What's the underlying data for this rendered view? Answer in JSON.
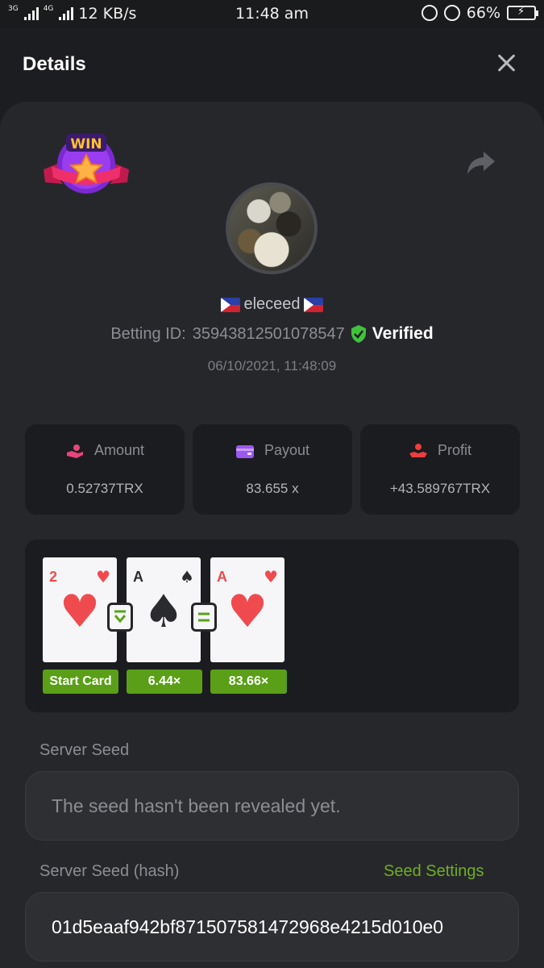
{
  "status_bar": {
    "network_left": "3G",
    "network_right": "4G",
    "speed": "12 KB/s",
    "time": "11:48 am",
    "battery": "66%",
    "battery_level": 0.66
  },
  "header": {
    "title": "Details"
  },
  "badge": {
    "text": "WIN"
  },
  "user": {
    "username": "eleceed",
    "betting_id_label": "Betting ID:",
    "betting_id": "35943812501078547",
    "verified_label": "Verified",
    "datetime": "06/10/2021, 11:48:09"
  },
  "stats": [
    {
      "label": "Amount",
      "value": "0.52737TRX",
      "icon": "hand-coin-icon",
      "color": "#e8457a"
    },
    {
      "label": "Payout",
      "value": "83.655 x",
      "icon": "wallet-icon",
      "color": "#9b59ef"
    },
    {
      "label": "Profit",
      "value": "+43.589767TRX",
      "icon": "hand-profit-icon",
      "color": "#ee3d3d"
    }
  ],
  "cards": [
    {
      "rank": "2",
      "suit": "♥",
      "color": "red",
      "multiplier": "Start Card"
    },
    {
      "rank": "A",
      "suit": "♠",
      "color": "black",
      "multiplier": "6.44×"
    },
    {
      "rank": "A",
      "suit": "♥",
      "color": "red",
      "multiplier": "83.66×"
    }
  ],
  "connectors": [
    "lower-equal-icon",
    "equal-icon"
  ],
  "server_seed": {
    "label": "Server Seed",
    "placeholder": "The seed hasn't been revealed yet."
  },
  "server_seed_hash": {
    "label": "Server Seed (hash)",
    "settings_link": "Seed Settings",
    "value": "01d5eaaf942bf871507581472968e4215d010e0"
  },
  "colors": {
    "accent_green": "#6fae22",
    "multiplier_green": "#5a9f17",
    "background": "#26272b"
  }
}
